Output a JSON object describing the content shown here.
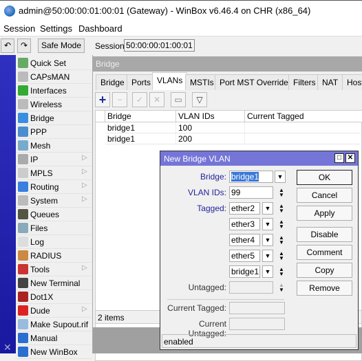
{
  "window": {
    "title": "admin@50:00:00:01:00:01 (Gateway) - WinBox v6.46.4 on CHR (x86_64)"
  },
  "menu": [
    "Session",
    "Settings",
    "Dashboard"
  ],
  "toolbar": {
    "undo": "↶",
    "redo": "↷",
    "safe_mode": "Safe Mode",
    "session_label": "Session:",
    "session_value": "50:00:00:01:00:01"
  },
  "sidebar": {
    "items": [
      {
        "label": "Quick Set",
        "icon": "quick-set-icon",
        "color": "#6a6"
      },
      {
        "label": "CAPsMAN",
        "icon": "antenna-icon",
        "color": "#bbb"
      },
      {
        "label": "Interfaces",
        "icon": "interfaces-icon",
        "color": "#3a3"
      },
      {
        "label": "Wireless",
        "icon": "antenna-icon",
        "color": "#bbb"
      },
      {
        "label": "Bridge",
        "icon": "bridge-icon",
        "color": "#3a8ee0"
      },
      {
        "label": "PPP",
        "icon": "ppp-icon",
        "color": "#4a8ed0"
      },
      {
        "label": "Mesh",
        "icon": "mesh-icon",
        "color": "#7ac"
      },
      {
        "label": "IP",
        "icon": "ip-icon",
        "color": "#aaa",
        "submenu": true
      },
      {
        "label": "MPLS",
        "icon": "mpls-icon",
        "color": "#ccc",
        "submenu": true
      },
      {
        "label": "Routing",
        "icon": "routing-icon",
        "color": "#3a7ee0",
        "submenu": true
      },
      {
        "label": "System",
        "icon": "system-icon",
        "color": "#bbb",
        "submenu": true
      },
      {
        "label": "Queues",
        "icon": "queues-icon",
        "color": "#554"
      },
      {
        "label": "Files",
        "icon": "files-icon",
        "color": "#8ab"
      },
      {
        "label": "Log",
        "icon": "log-icon",
        "color": "#ddd"
      },
      {
        "label": "RADIUS",
        "icon": "radius-icon",
        "color": "#c84"
      },
      {
        "label": "Tools",
        "icon": "tools-icon",
        "color": "#c33",
        "submenu": true
      },
      {
        "label": "New Terminal",
        "icon": "terminal-icon",
        "color": "#444"
      },
      {
        "label": "Dot1X",
        "icon": "dot1x-icon",
        "color": "#a22"
      },
      {
        "label": "Dude",
        "icon": "dude-icon",
        "color": "#d22",
        "submenu": true
      },
      {
        "label": "Make Supout.rif",
        "icon": "supout-icon",
        "color": "#9bd"
      },
      {
        "label": "Manual",
        "icon": "help-icon",
        "color": "#2a6ed0"
      },
      {
        "label": "New WinBox",
        "icon": "winbox-icon",
        "color": "#2a6ed0"
      }
    ]
  },
  "bridge_window": {
    "title": "Bridge",
    "tabs": [
      "Bridge",
      "Ports",
      "VLANs",
      "MSTIs",
      "Port MST Overrides",
      "Filters",
      "NAT",
      "Host"
    ],
    "active_tab": "VLANs",
    "columns": [
      "Bridge",
      "VLAN IDs",
      "Current Tagged"
    ],
    "rows": [
      [
        "bridge1",
        "100",
        ""
      ],
      [
        "bridge1",
        "200",
        ""
      ]
    ],
    "status": "2 items"
  },
  "dialog": {
    "title": "New Bridge VLAN",
    "bridge_label": "Bridge:",
    "bridge_value": "bridge1",
    "vlan_ids_label": "VLAN IDs:",
    "vlan_ids_value": "99",
    "tagged_label": "Tagged:",
    "tagged": [
      "ether2",
      "ether3",
      "ether4",
      "ether5",
      "bridge1"
    ],
    "untagged_label": "Untagged:",
    "untagged_value": "",
    "current_tagged_label": "Current Tagged:",
    "current_untagged_label": "Current Untagged:",
    "buttons": [
      "OK",
      "Cancel",
      "Apply",
      "Disable",
      "Comment",
      "Copy",
      "Remove"
    ],
    "status": "enabled"
  }
}
